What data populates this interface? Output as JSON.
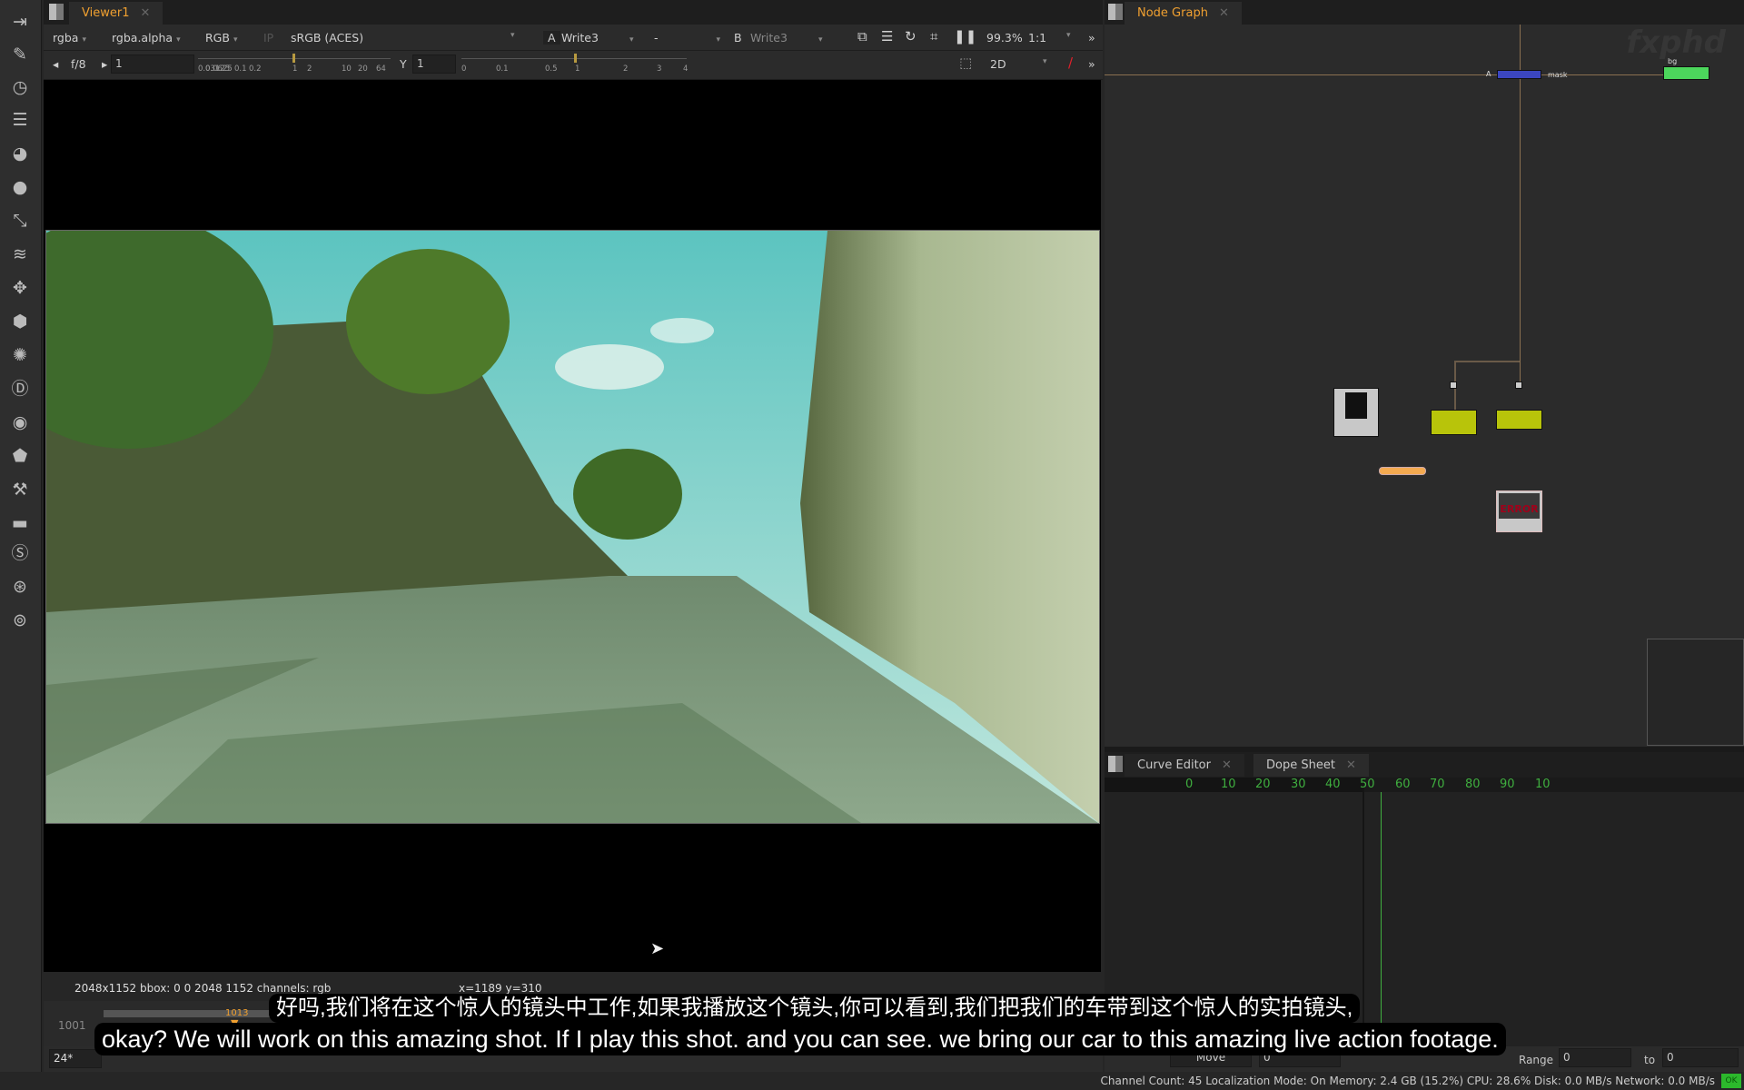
{
  "viewer": {
    "tab": "Viewer1",
    "channels": "rgba",
    "alpha": "rgba.alpha",
    "display": "RGB",
    "ip": "IP",
    "colorspace": "sRGB (ACES)",
    "input_a_label": "A",
    "input_a": "Write3",
    "wipe": "-",
    "input_b_label": "B",
    "input_b": "Write3",
    "zoom": "99.3%",
    "ratio": "1:1",
    "fstop": "f/8",
    "gain": "1",
    "gamma_label": "Y",
    "gamma": "1",
    "mode": "2D",
    "gain_ticks": [
      "0.03125",
      "0.0625",
      "0.1",
      "0.2",
      "1",
      "2",
      "10",
      "20",
      "64"
    ],
    "gamma_ticks": [
      "0",
      "0.1",
      "0.5",
      "1",
      "2",
      "3",
      "4"
    ],
    "info": "2048x1152  bbox: 0 0 2048 1152 channels: rgb",
    "coords": "x=1189 y=310"
  },
  "timeline": {
    "start": "1001",
    "current": "1013",
    "fps": "24*"
  },
  "subtitles": {
    "zh": "好吗,我们将在这个惊人的镜头中工作,如果我播放这个镜头,你可以看到,我们把我们的车带到这个惊人的实拍镜头,",
    "en": "okay? We will work on this amazing shot. If I play this shot. and you can see. we bring our car to this amazing live action footage."
  },
  "nodegraph": {
    "tab": "Node Graph",
    "watermark": "fxphd",
    "labels": {
      "a": "A",
      "mask": "mask",
      "bg": "bg",
      "error": "ERROR"
    }
  },
  "dopesheet": {
    "tabs": [
      {
        "label": "Curve Editor"
      },
      {
        "label": "Dope Sheet"
      }
    ],
    "ticks": [
      "0",
      "10",
      "20",
      "30",
      "40",
      "50",
      "60",
      "70",
      "80",
      "90",
      "10"
    ],
    "move": "Move",
    "move_value": "0",
    "range_label": "Range",
    "range_from": "0",
    "to_label": "to",
    "range_to": "0"
  },
  "status": {
    "text": "Channel Count: 45 Localization Mode: On  Memory: 2.4 GB (15.2%) CPU: 28.6% Disk: 0.0 MB/s Network: 0.0 MB/s",
    "ok": "OK"
  },
  "colors": {
    "accent": "#f0a030",
    "merge_node": "#3b46c0",
    "green_node": "#4cd65c",
    "grade_node": "#b8c40a",
    "error": "#a0001a"
  }
}
